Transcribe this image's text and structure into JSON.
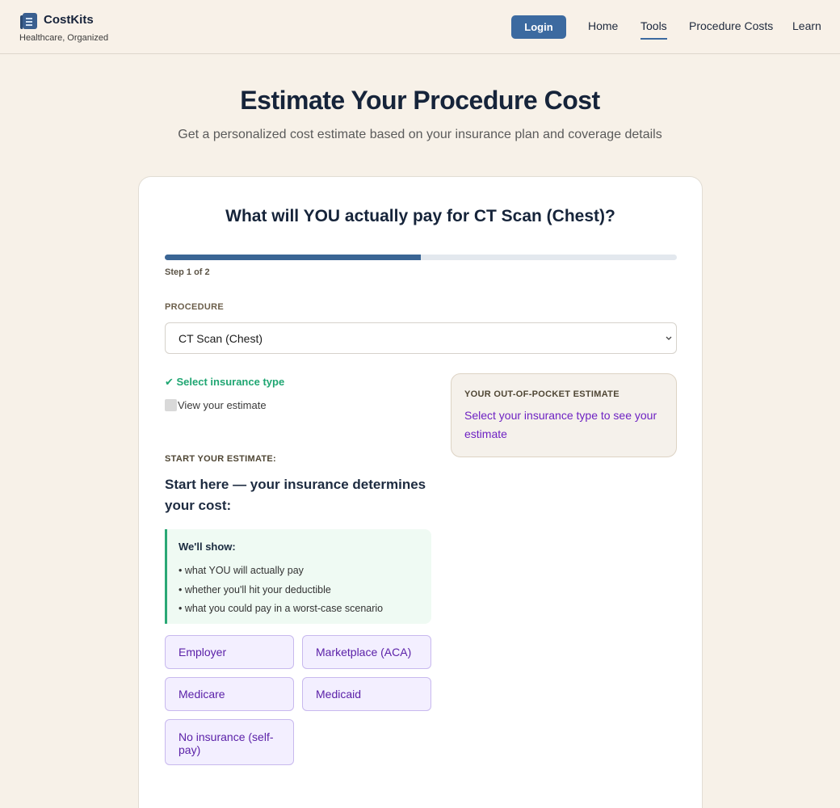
{
  "header": {
    "brand_name": "CostKits",
    "tagline": "Healthcare, Organized",
    "login_label": "Login",
    "nav": {
      "home": "Home",
      "tools": "Tools",
      "procedure_costs": "Procedure Costs",
      "learn": "Learn"
    },
    "active_nav": "Tools",
    "accent_color": "#3c6aa0"
  },
  "hero": {
    "title": "Estimate Your Procedure Cost",
    "subtitle": "Get a personalized cost estimate based on your insurance plan and coverage details"
  },
  "card": {
    "title": "What will YOU actually pay for CT Scan (Chest)?",
    "progress": {
      "fraction": 0.5,
      "step_text": "Step 1 of 2"
    },
    "procedure": {
      "label": "PROCEDURE",
      "selected": "CT Scan (Chest)"
    },
    "steps": {
      "step1": "✔ Select insurance type",
      "step2": "View your estimate"
    },
    "estimate_panel": {
      "label": "YOUR OUT-OF-POCKET ESTIMATE",
      "message": "Select your insurance type to see your estimate"
    },
    "start": {
      "label": "START YOUR ESTIMATE:",
      "heading": "Start here — your insurance determines your cost:"
    },
    "info": {
      "title": "We'll show:",
      "items": [
        "• what YOU will actually pay",
        "• whether you'll hit your deductible",
        "• what you could pay in a worst-case scenario"
      ]
    },
    "insurance_options": {
      "employer": "Employer",
      "marketplace": "Marketplace (ACA)",
      "medicare": "Medicare",
      "medicaid": "Medicaid",
      "none": "No insurance (self-pay)"
    }
  },
  "icons": {
    "logo": "clipboard-icon",
    "select_arrow": "chevron-down-icon",
    "step_done": "checkmark-icon",
    "step_pending": "checkbox-icon"
  }
}
